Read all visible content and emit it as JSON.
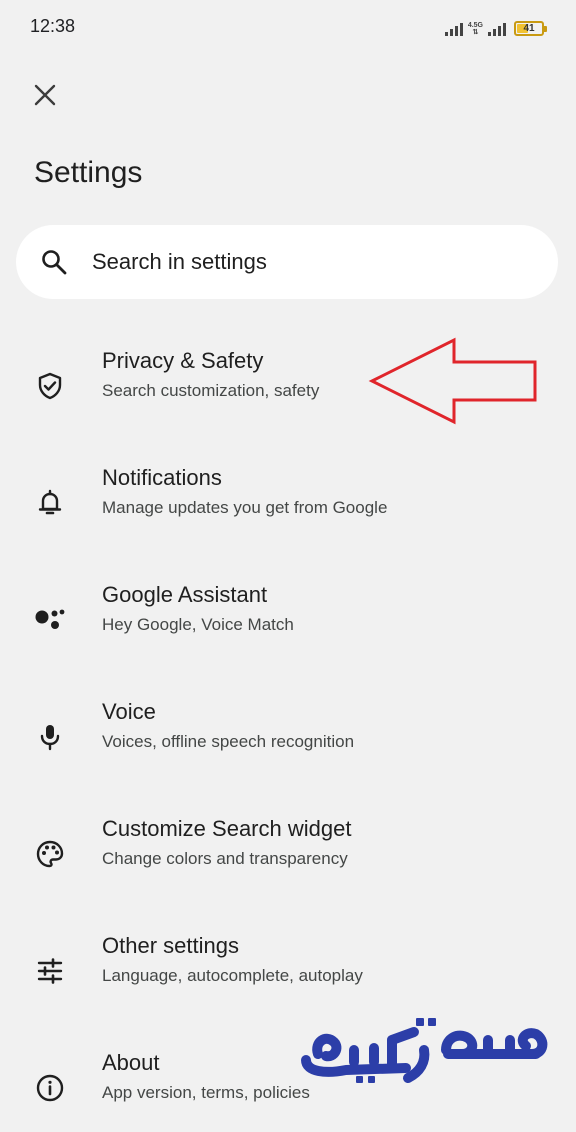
{
  "status_bar": {
    "time": "12:38",
    "network": "4.5G",
    "battery": "41",
    "battery_color": "#f1c232"
  },
  "header": {
    "close_icon": "close-icon",
    "title": "Settings"
  },
  "search": {
    "placeholder": "Search in settings",
    "icon": "search-icon"
  },
  "menu": {
    "items": [
      {
        "title": "Privacy & Safety",
        "subtitle": "Search customization, safety",
        "icon": "shield-icon"
      },
      {
        "title": "Notifications",
        "subtitle": "Manage updates you get from Google",
        "icon": "bell-icon"
      },
      {
        "title": "Google Assistant",
        "subtitle": "Hey Google, Voice Match",
        "icon": "assistant-icon"
      },
      {
        "title": "Voice",
        "subtitle": "Voices, offline speech recognition",
        "icon": "microphone-icon"
      },
      {
        "title": "Customize Search widget",
        "subtitle": "Change colors and transparency",
        "icon": "palette-icon"
      },
      {
        "title": "Other settings",
        "subtitle": "Language, autocomplete, autoplay",
        "icon": "sliders-icon"
      },
      {
        "title": "About",
        "subtitle": "App version, terms, policies",
        "icon": "info-icon"
      }
    ]
  },
  "annotation": {
    "arrow_color": "#e0252b"
  },
  "watermark": {
    "text": "عصر ترکیه",
    "color": "#2c3ea8"
  }
}
